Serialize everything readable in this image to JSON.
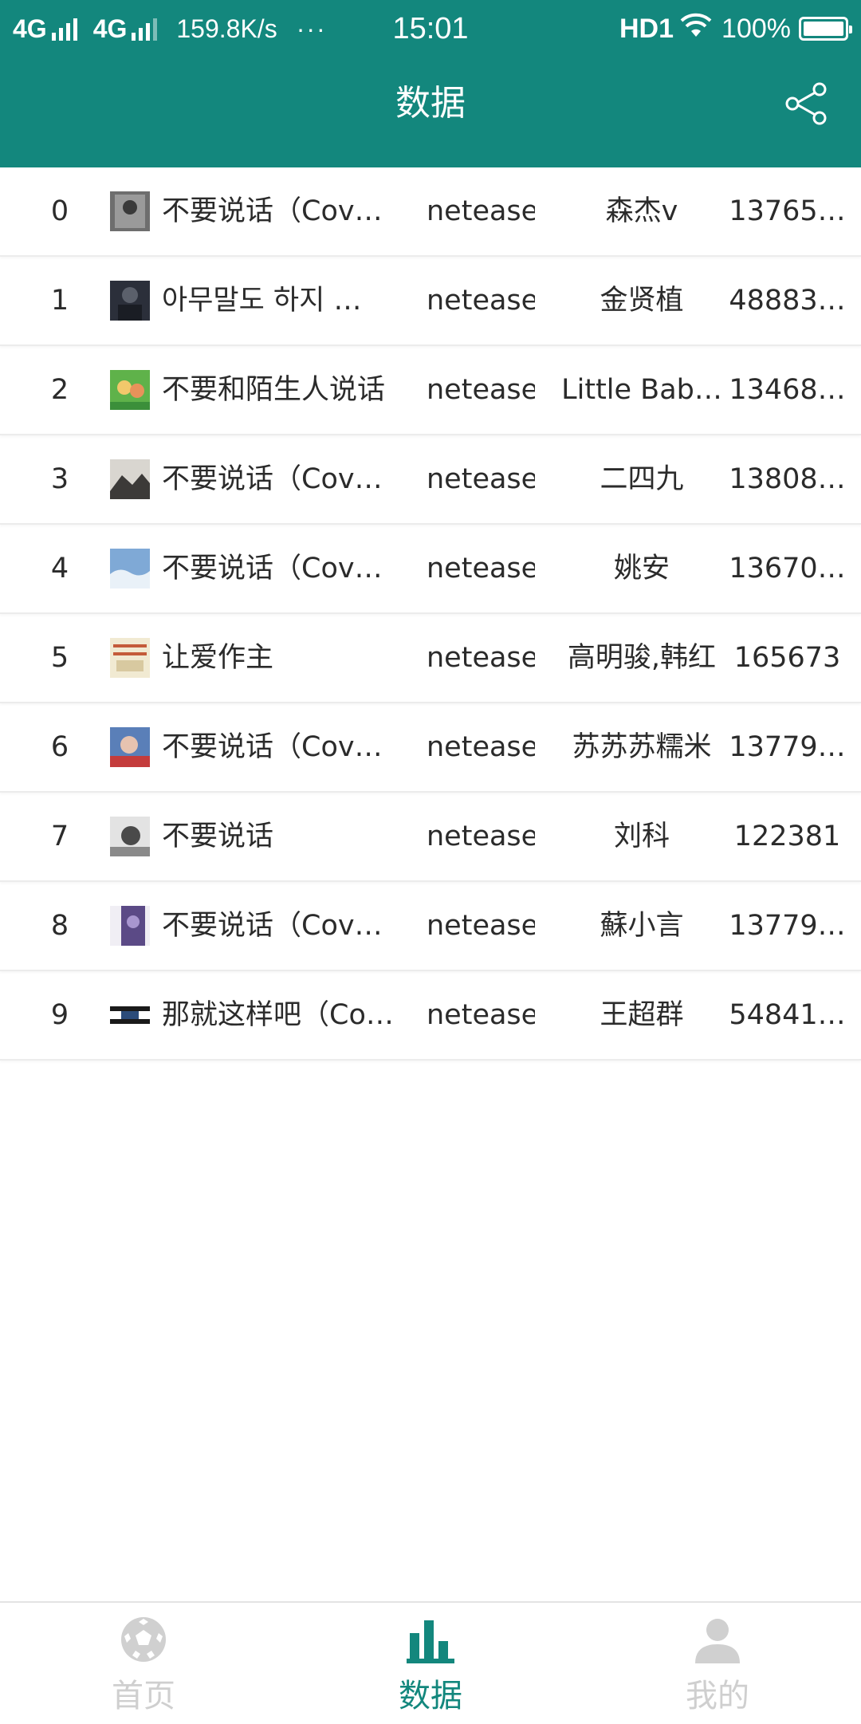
{
  "status_bar": {
    "net1": "4G",
    "net2": "4G",
    "speed": "159.8K/s",
    "more": "···",
    "time": "15:01",
    "hd": "HD1",
    "battery": "100%"
  },
  "header": {
    "title": "数据",
    "share_icon": "share-icon"
  },
  "rows": [
    {
      "idx": "0",
      "title": "不要说话（Cov…",
      "source": "netease",
      "artist": "森杰v",
      "id": "13765…"
    },
    {
      "idx": "1",
      "title": "아무말도 하지 …",
      "source": "netease",
      "artist": "金贤植",
      "id": "48883…"
    },
    {
      "idx": "2",
      "title": "不要和陌生人说话",
      "source": "netease",
      "artist": "Little Bab…",
      "id": "13468…"
    },
    {
      "idx": "3",
      "title": "不要说话（Cov…",
      "source": "netease",
      "artist": "二四九",
      "id": "13808…"
    },
    {
      "idx": "4",
      "title": "不要说话（Cov…",
      "source": "netease",
      "artist": "姚安",
      "id": "13670…"
    },
    {
      "idx": "5",
      "title": "让爱作主",
      "source": "netease",
      "artist": "高明骏,韩红",
      "id": "165673"
    },
    {
      "idx": "6",
      "title": "不要说话（Cov…",
      "source": "netease",
      "artist": "苏苏苏糯米",
      "id": "13779…"
    },
    {
      "idx": "7",
      "title": "不要说话",
      "source": "netease",
      "artist": "刘科",
      "id": "122381"
    },
    {
      "idx": "8",
      "title": "不要说话（Cov…",
      "source": "netease",
      "artist": "蘇小言",
      "id": "13779…"
    },
    {
      "idx": "9",
      "title": "那就这样吧（Co…",
      "source": "netease",
      "artist": "王超群",
      "id": "54841…"
    }
  ],
  "tabs": [
    {
      "label": "首页",
      "icon": "soccer-ball-icon"
    },
    {
      "label": "数据",
      "icon": "bar-chart-icon"
    },
    {
      "label": "我的",
      "icon": "user-icon"
    }
  ],
  "colors": {
    "brand": "#13877d",
    "inactive": "#cfcfcf"
  }
}
